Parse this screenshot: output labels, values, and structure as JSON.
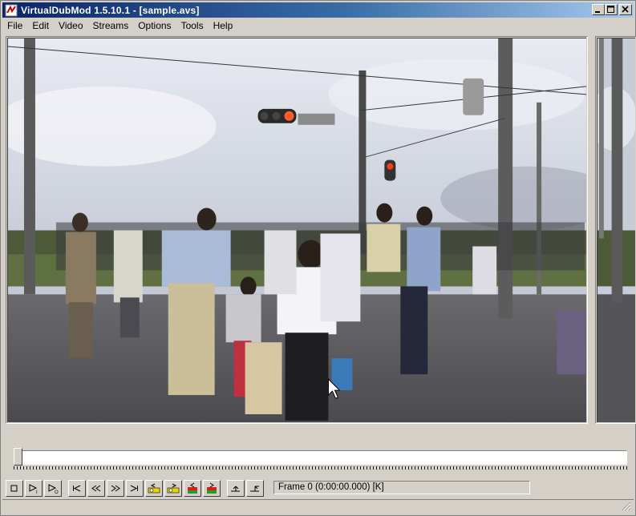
{
  "window": {
    "title": "VirtualDubMod 1.5.10.1 - [sample.avs]",
    "accent": "#0a246a"
  },
  "menu": [
    {
      "label": "File"
    },
    {
      "label": "Edit"
    },
    {
      "label": "Video"
    },
    {
      "label": "Streams"
    },
    {
      "label": "Options"
    },
    {
      "label": "Tools"
    },
    {
      "label": "Help"
    }
  ],
  "panes": {
    "input_icon": "video-frame-image",
    "output_icon": "video-frame-image"
  },
  "position_slider": {
    "position_fraction": 0.0
  },
  "toolbar": {
    "buttons": [
      {
        "name": "stop-button",
        "icon": "stop-icon"
      },
      {
        "name": "play-input-button",
        "icon": "play-input-icon"
      },
      {
        "name": "play-output-button",
        "icon": "play-output-icon"
      },
      {
        "name": "go-start-button",
        "icon": "go-start-icon"
      },
      {
        "name": "step-back-button",
        "icon": "step-back-icon"
      },
      {
        "name": "step-forward-button",
        "icon": "step-forward-icon"
      },
      {
        "name": "go-end-button",
        "icon": "go-end-icon"
      },
      {
        "name": "prev-keyframe-button",
        "icon": "key-prev-icon"
      },
      {
        "name": "next-keyframe-button",
        "icon": "key-next-icon"
      },
      {
        "name": "prev-scene-button",
        "icon": "scene-prev-icon"
      },
      {
        "name": "next-scene-button",
        "icon": "scene-next-icon"
      },
      {
        "name": "mark-in-button",
        "icon": "mark-in-icon"
      },
      {
        "name": "mark-out-button",
        "icon": "mark-out-icon"
      }
    ]
  },
  "status": {
    "frame_text": "Frame 0 (0:00:00.000) [K]"
  }
}
